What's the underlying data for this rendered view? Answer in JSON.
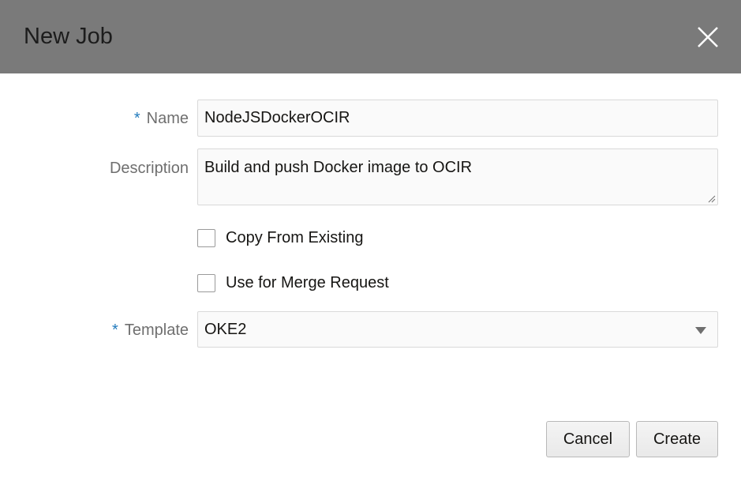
{
  "dialog": {
    "title": "New Job",
    "close_icon": "close-icon"
  },
  "form": {
    "name": {
      "label": "Name",
      "required_marker": "*",
      "value": "NodeJSDockerOCIR"
    },
    "description": {
      "label": "Description",
      "value": "Build and push Docker image to OCIR"
    },
    "copy_from_existing": {
      "label": "Copy From Existing",
      "checked": false
    },
    "use_for_merge_request": {
      "label": "Use for Merge Request",
      "checked": false
    },
    "template": {
      "label": "Template",
      "required_marker": "*",
      "value": "OKE2"
    }
  },
  "buttons": {
    "cancel": "Cancel",
    "create": "Create"
  },
  "colors": {
    "header_bg": "#7a7a7a",
    "required_marker": "#227bbd",
    "label_text": "#6f6f6f"
  }
}
